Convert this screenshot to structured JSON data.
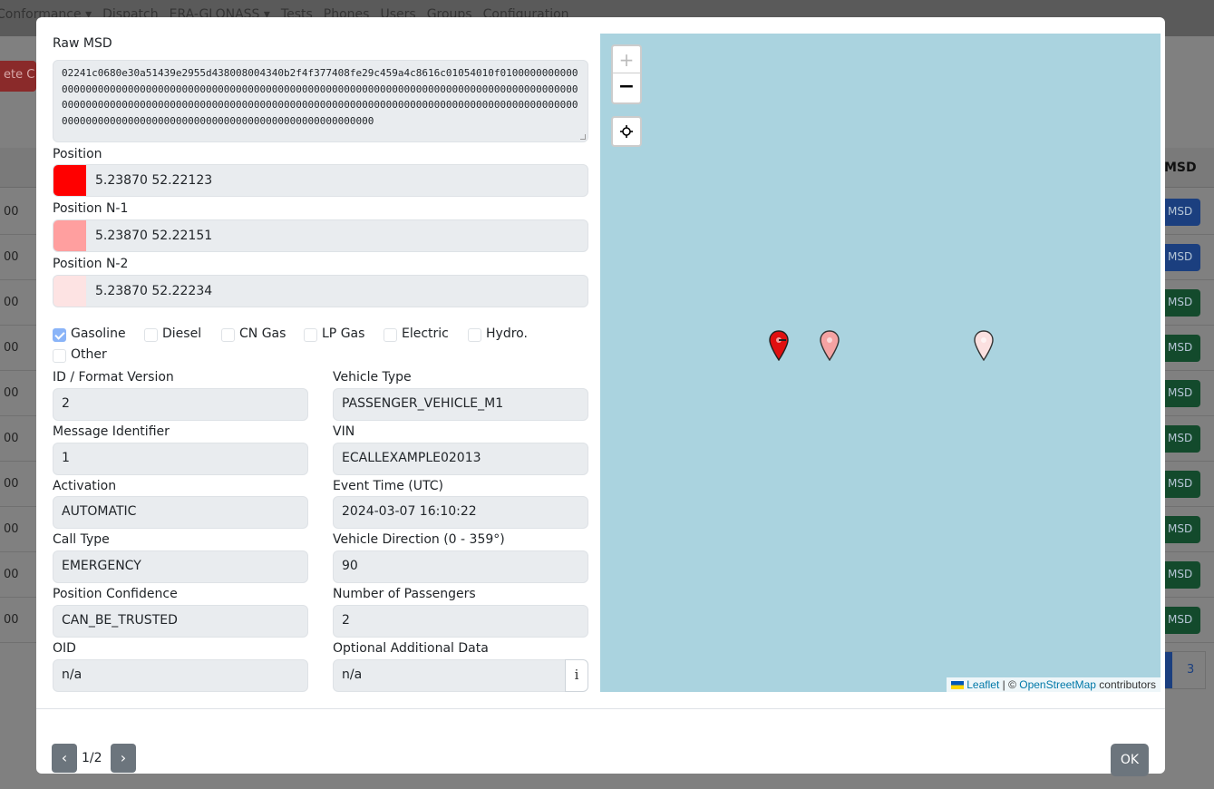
{
  "background": {
    "nav_items": [
      "Conformance ▾",
      "Dispatch",
      "ERA-GLONASS ▾",
      "Tests",
      "Phones",
      "Users",
      "Groups",
      "Configuration"
    ],
    "delete_label": "ete C",
    "msd_header": "MSD",
    "row_prefix": "00",
    "msd_button": "MSD",
    "page_number": "3"
  },
  "raw_msd": {
    "label": "Raw MSD",
    "value": "02241c0680e30a51439e2955d438008004340b2f4f377408fe29c459a4c8616c01054010f010000000000000000000000000000000000000000000000000000000000000000000000000000000000000000000000000000000000000000000000000000000000000000000000000000000000000000000000000000000000000000000000000000000000000000000000000000000000000000000"
  },
  "positions": [
    {
      "label": "Position",
      "value": "5.23870 52.22123",
      "color": "#ff0000"
    },
    {
      "label": "Position N-1",
      "value": "5.23870 52.22151",
      "color": "#ff9f9f"
    },
    {
      "label": "Position N-2",
      "value": "5.23870 52.22234",
      "color": "#fde3e3"
    }
  ],
  "fuel_types": [
    {
      "label": "Gasoline",
      "checked": true
    },
    {
      "label": "Diesel",
      "checked": false
    },
    {
      "label": "CN Gas",
      "checked": false
    },
    {
      "label": "LP Gas",
      "checked": false
    },
    {
      "label": "Electric",
      "checked": false
    },
    {
      "label": "Hydro.",
      "checked": false
    },
    {
      "label": "Other",
      "checked": false
    }
  ],
  "fields": {
    "id_format_version": {
      "label": "ID / Format Version",
      "value": "2"
    },
    "vehicle_type": {
      "label": "Vehicle Type",
      "value": "PASSENGER_VEHICLE_M1"
    },
    "message_identifier": {
      "label": "Message Identifier",
      "value": "1"
    },
    "vin": {
      "label": "VIN",
      "value": "ECALLEXAMPLE02013"
    },
    "activation": {
      "label": "Activation",
      "value": "AUTOMATIC"
    },
    "event_time": {
      "label": "Event Time (UTC)",
      "value": "2024-03-07 16:10:22"
    },
    "call_type": {
      "label": "Call Type",
      "value": "EMERGENCY"
    },
    "vehicle_direction": {
      "label": "Vehicle Direction (0 - 359°)",
      "value": "90"
    },
    "position_confidence": {
      "label": "Position Confidence",
      "value": "CAN_BE_TRUSTED"
    },
    "number_of_passengers": {
      "label": "Number of Passengers",
      "value": "2"
    },
    "oid": {
      "label": "OID",
      "value": "n/a"
    },
    "optional_additional_data": {
      "label": "Optional Additional Data",
      "value": "n/a",
      "info_label": "i"
    }
  },
  "map": {
    "zoom_in": "+",
    "zoom_out": "−",
    "attribution_leaflet": "Leaflet",
    "attribution_sep": " | © ",
    "attribution_osm": "OpenStreetMap",
    "attribution_suffix": " contributors",
    "marker_colors": [
      "#e01010",
      "#f5a3a3",
      "#fbe0e0"
    ]
  },
  "footer": {
    "prev": "‹",
    "page": "1/2",
    "next": "›",
    "ok_label": "OK"
  }
}
